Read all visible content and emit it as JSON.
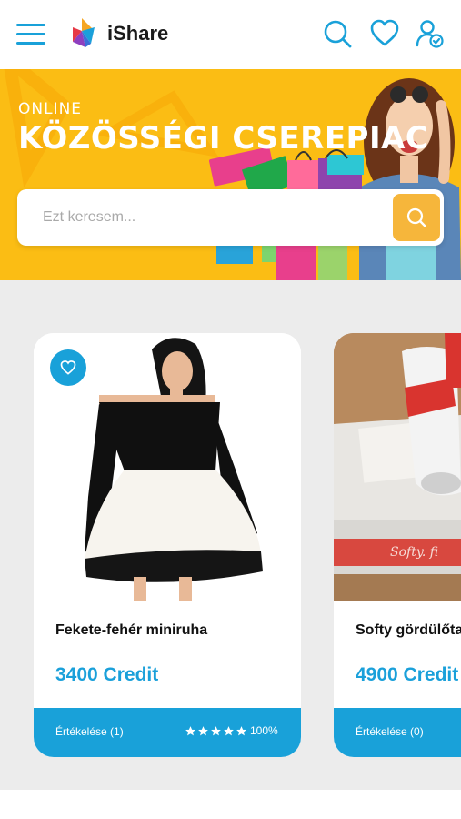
{
  "header": {
    "menu_icon": "hamburger-menu-icon",
    "brand": "iShare",
    "icons": [
      "search-icon",
      "heart-icon",
      "user-check-icon"
    ]
  },
  "hero": {
    "kicker": "ONLINE",
    "title": "KÖZÖSSÉGI CSEREPIAC",
    "search": {
      "placeholder": "Ezt keresem...",
      "value": "",
      "button_icon": "search-icon"
    },
    "colors": {
      "background": "#fbbd14",
      "search_button": "#f6b63b"
    }
  },
  "products": [
    {
      "title": "Fekete-fehér miniruha",
      "price": "3400 Credit",
      "rating_label": "Értékelése (1)",
      "stars": 5,
      "rating_percent": "100%",
      "favorite_icon": "heart-icon"
    },
    {
      "title": "Softy gördülőta",
      "price": "4900 Credit",
      "rating_label": "Értékelése (0)"
    }
  ],
  "colors": {
    "accent": "#19a1d9",
    "price": "#1aa0da",
    "listing_bg": "#ececec"
  }
}
